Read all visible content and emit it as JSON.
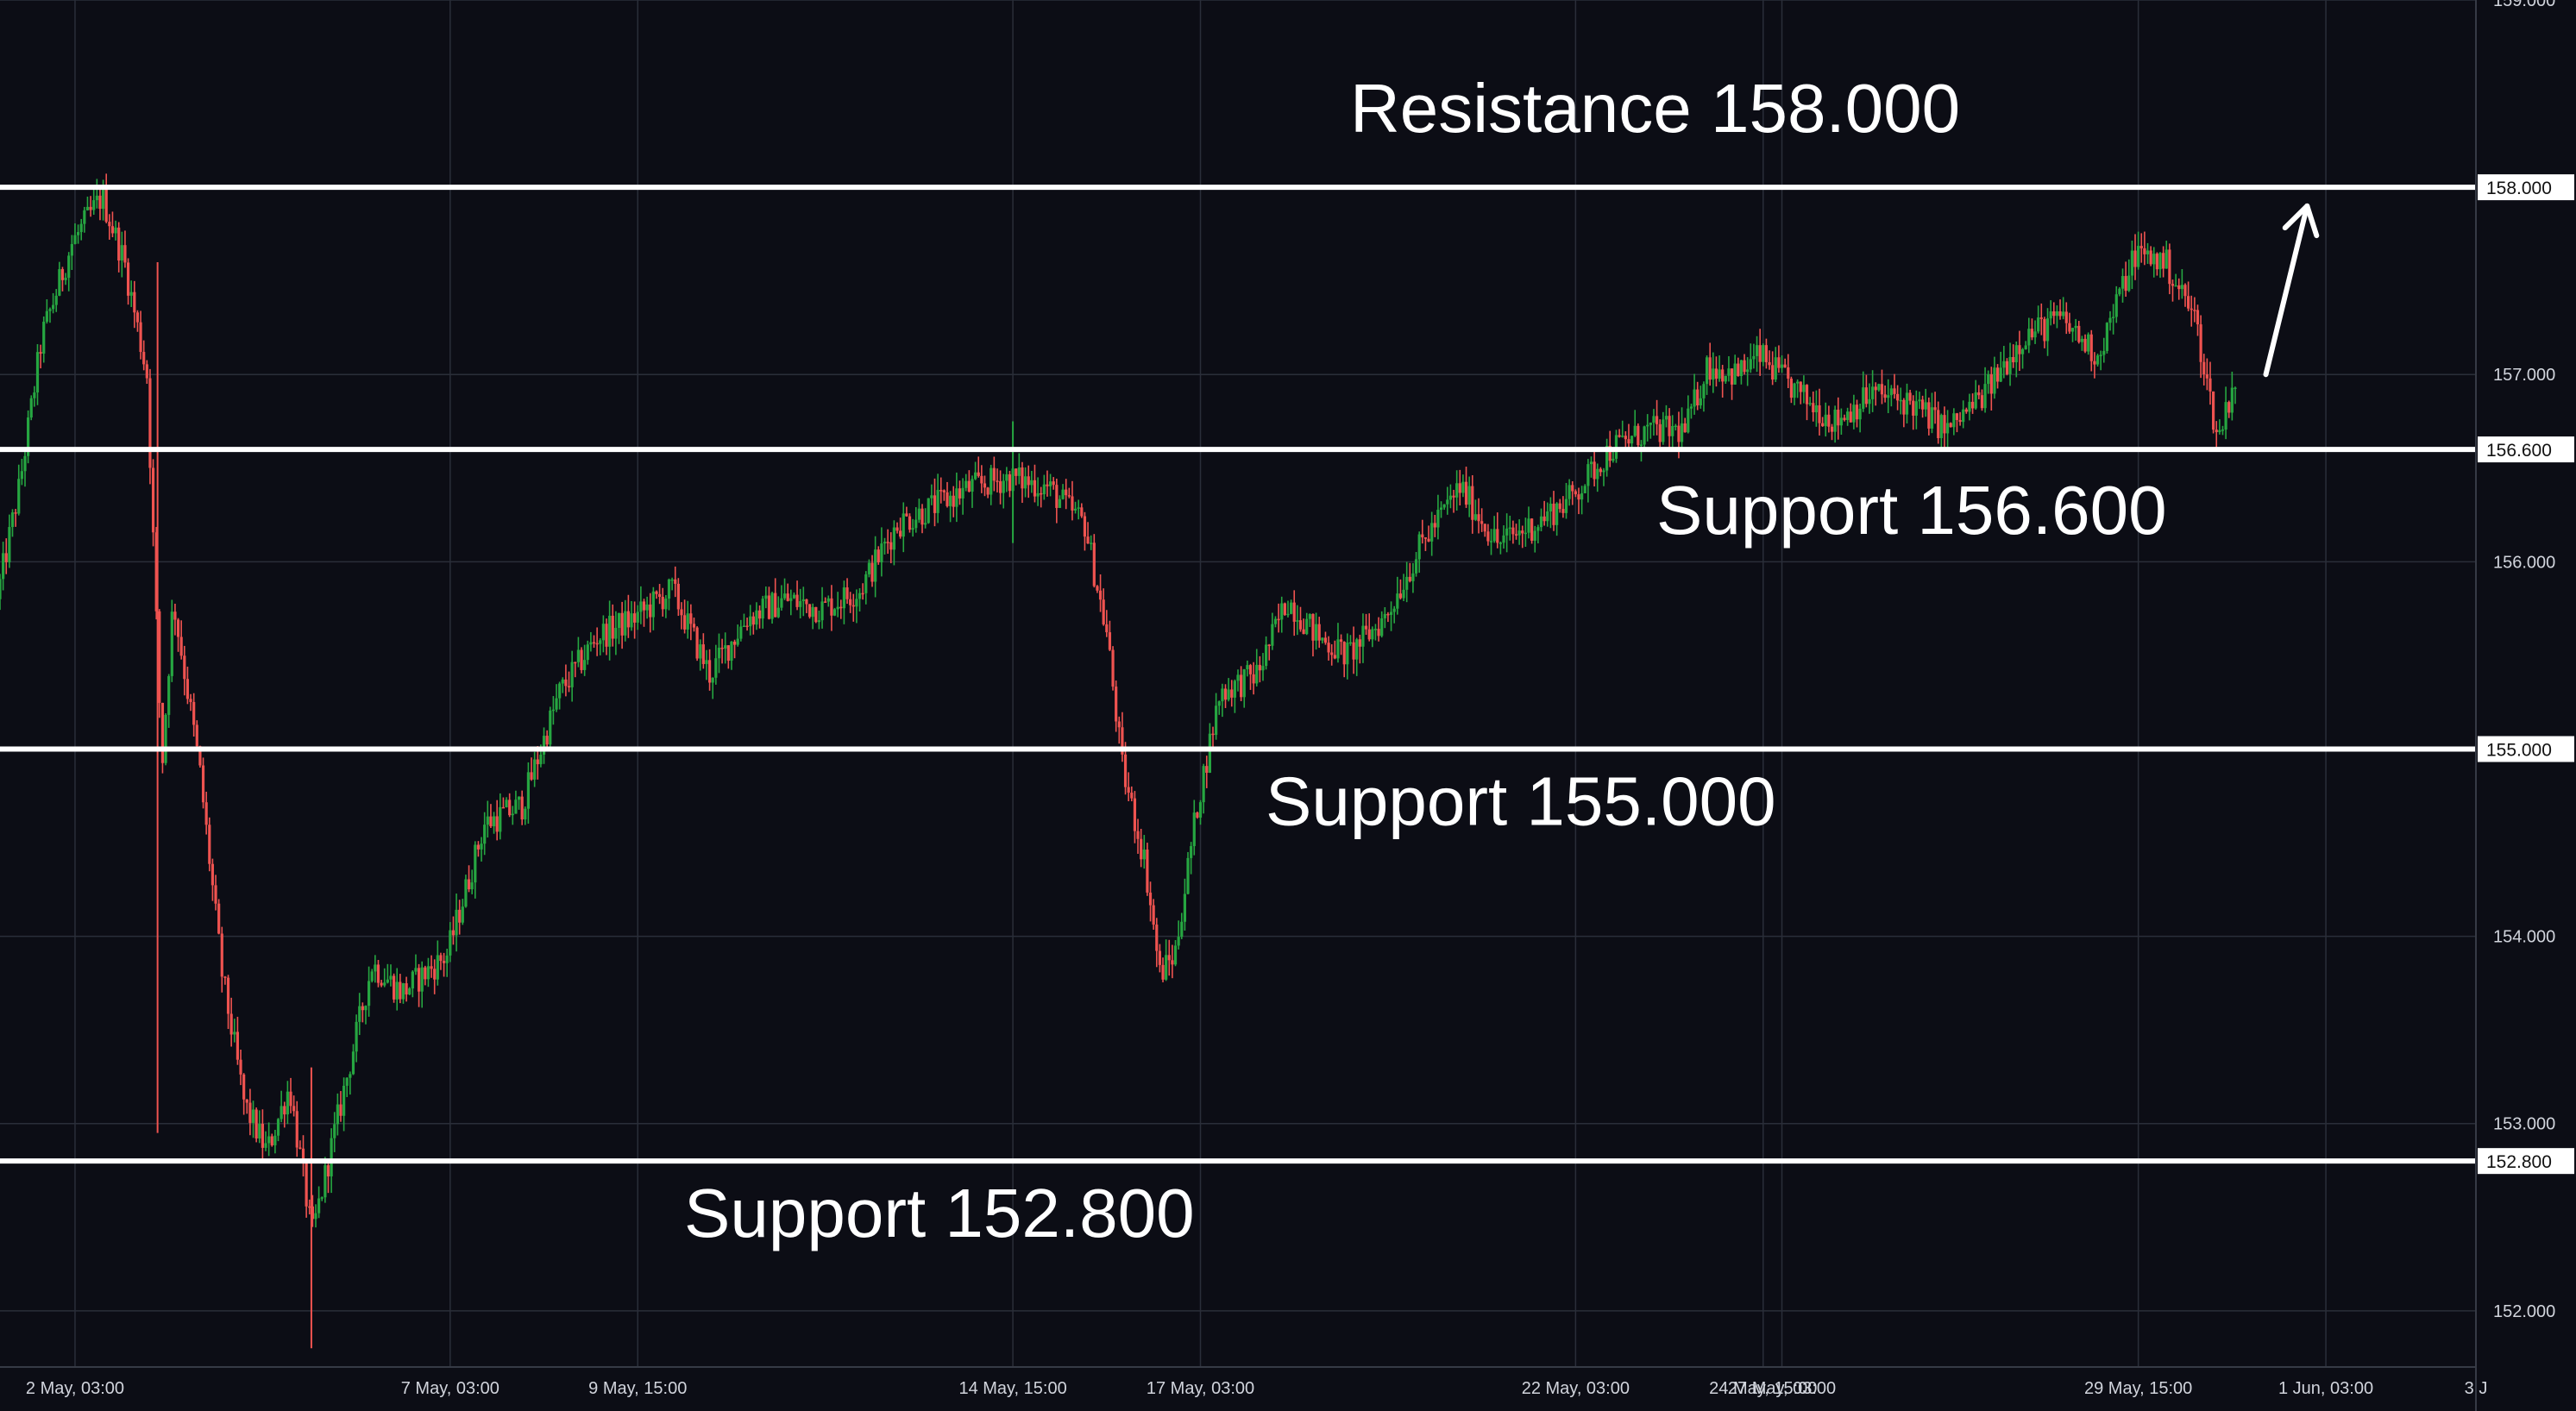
{
  "chart_data": {
    "type": "candlestick",
    "title": "",
    "xlabel": "",
    "ylabel": "",
    "ylim": [
      151.7,
      159.0
    ],
    "grid": true,
    "colors": {
      "background": "#0c0d15",
      "grid": "#2a2e39",
      "up": "#26a641",
      "down": "#ef5350",
      "level_line": "#ffffff",
      "axis_text": "#d1d4dc"
    },
    "y_ticks": [
      "159.000",
      "157.000",
      "156.000",
      "154.000",
      "153.000",
      "152.000"
    ],
    "x_ticks": [
      {
        "label": "2 May, 03:00",
        "t": 1.0
      },
      {
        "label": "7 May, 03:00",
        "t": 6.0
      },
      {
        "label": "9 May, 15:00",
        "t": 8.5
      },
      {
        "label": "14 May, 15:00",
        "t": 13.5
      },
      {
        "label": "17 May, 03:00",
        "t": 16.0
      },
      {
        "label": "22 May, 03:00",
        "t": 21.0
      },
      {
        "label": "24 May, 15:00",
        "t": 23.5
      },
      {
        "label": "27 May, 03:00",
        "t": 23.75
      },
      {
        "label": "29 May, 15:00",
        "t": 28.5
      },
      {
        "label": "1 Jun, 03:00",
        "t": 31.0
      },
      {
        "label": "3 J",
        "t": 33.0
      }
    ],
    "levels": [
      {
        "name": "Resistance 158.000",
        "value": 158.0,
        "tag": "158.000"
      },
      {
        "name": "Support 156.600",
        "value": 156.6,
        "tag": "156.600"
      },
      {
        "name": "Support 155.000",
        "value": 155.0,
        "tag": "155.000"
      },
      {
        "name": "Support 152.800",
        "value": 152.8,
        "tag": "152.800"
      }
    ],
    "annotations": [
      {
        "type": "arrow",
        "from": {
          "t": 30.2,
          "price": 157.0
        },
        "to": {
          "t": 30.75,
          "price": 157.9
        }
      }
    ],
    "price_path": [
      {
        "t": 0.0,
        "price": 155.8
      },
      {
        "t": 0.3,
        "price": 156.4
      },
      {
        "t": 0.6,
        "price": 157.2
      },
      {
        "t": 1.0,
        "price": 157.7
      },
      {
        "t": 1.4,
        "price": 157.95
      },
      {
        "t": 1.7,
        "price": 157.6
      },
      {
        "t": 2.0,
        "price": 157.0
      },
      {
        "t": 2.2,
        "price": 154.9
      },
      {
        "t": 2.35,
        "price": 155.8
      },
      {
        "t": 2.7,
        "price": 154.9
      },
      {
        "t": 3.0,
        "price": 153.8
      },
      {
        "t": 3.3,
        "price": 153.1
      },
      {
        "t": 3.6,
        "price": 152.85
      },
      {
        "t": 3.9,
        "price": 153.2
      },
      {
        "t": 4.2,
        "price": 152.4
      },
      {
        "t": 4.5,
        "price": 152.95
      },
      {
        "t": 5.0,
        "price": 153.85
      },
      {
        "t": 5.4,
        "price": 153.7
      },
      {
        "t": 6.0,
        "price": 153.9
      },
      {
        "t": 6.5,
        "price": 154.6
      },
      {
        "t": 7.0,
        "price": 154.7
      },
      {
        "t": 7.5,
        "price": 155.3
      },
      {
        "t": 8.0,
        "price": 155.6
      },
      {
        "t": 8.5,
        "price": 155.7
      },
      {
        "t": 9.0,
        "price": 155.85
      },
      {
        "t": 9.5,
        "price": 155.4
      },
      {
        "t": 10.0,
        "price": 155.7
      },
      {
        "t": 10.5,
        "price": 155.8
      },
      {
        "t": 11.0,
        "price": 155.75
      },
      {
        "t": 11.5,
        "price": 155.85
      },
      {
        "t": 12.0,
        "price": 156.2
      },
      {
        "t": 12.5,
        "price": 156.3
      },
      {
        "t": 13.0,
        "price": 156.4
      },
      {
        "t": 13.5,
        "price": 156.45
      },
      {
        "t": 14.0,
        "price": 156.4
      },
      {
        "t": 14.5,
        "price": 156.2
      },
      {
        "t": 14.8,
        "price": 155.6
      },
      {
        "t": 15.0,
        "price": 154.9
      },
      {
        "t": 15.3,
        "price": 154.4
      },
      {
        "t": 15.5,
        "price": 153.8
      },
      {
        "t": 15.7,
        "price": 153.9
      },
      {
        "t": 16.0,
        "price": 154.7
      },
      {
        "t": 16.3,
        "price": 155.3
      },
      {
        "t": 16.8,
        "price": 155.4
      },
      {
        "t": 17.2,
        "price": 155.8
      },
      {
        "t": 17.6,
        "price": 155.6
      },
      {
        "t": 18.0,
        "price": 155.5
      },
      {
        "t": 18.5,
        "price": 155.7
      },
      {
        "t": 19.0,
        "price": 156.1
      },
      {
        "t": 19.5,
        "price": 156.4
      },
      {
        "t": 20.0,
        "price": 156.1
      },
      {
        "t": 20.5,
        "price": 156.2
      },
      {
        "t": 21.0,
        "price": 156.35
      },
      {
        "t": 21.5,
        "price": 156.6
      },
      {
        "t": 22.0,
        "price": 156.7
      },
      {
        "t": 22.5,
        "price": 156.7
      },
      {
        "t": 22.8,
        "price": 157.05
      },
      {
        "t": 23.2,
        "price": 157.0
      },
      {
        "t": 23.5,
        "price": 157.1
      },
      {
        "t": 24.0,
        "price": 156.9
      },
      {
        "t": 24.5,
        "price": 156.75
      },
      {
        "t": 25.0,
        "price": 156.9
      },
      {
        "t": 25.5,
        "price": 156.85
      },
      {
        "t": 26.0,
        "price": 156.7
      },
      {
        "t": 26.5,
        "price": 156.9
      },
      {
        "t": 27.0,
        "price": 157.2
      },
      {
        "t": 27.5,
        "price": 157.3
      },
      {
        "t": 28.0,
        "price": 157.1
      },
      {
        "t": 28.5,
        "price": 157.65
      },
      {
        "t": 28.9,
        "price": 157.6
      },
      {
        "t": 29.3,
        "price": 157.3
      },
      {
        "t": 29.6,
        "price": 156.65
      },
      {
        "t": 29.8,
        "price": 156.95
      }
    ]
  }
}
